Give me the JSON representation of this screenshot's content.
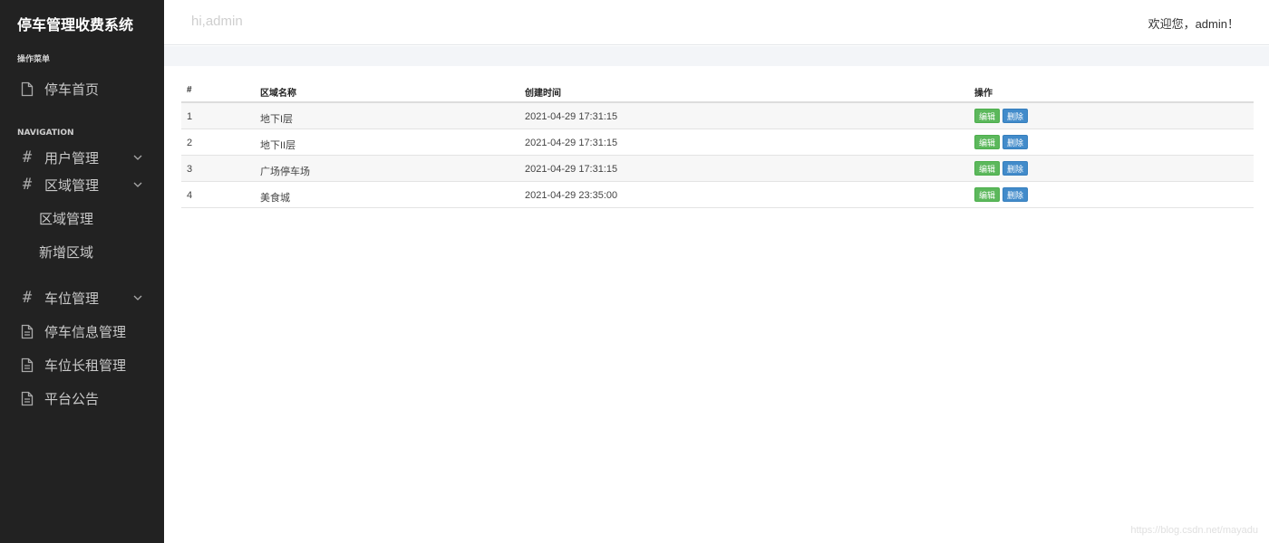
{
  "app": {
    "title": "停车管理收费系统"
  },
  "sidebar": {
    "menu_label": "操作菜单",
    "home_label": "停车首页",
    "nav_label": "NAVIGATION",
    "user_mgmt": "用户管理",
    "area_mgmt": "区域管理",
    "area_sub_list": "区域管理",
    "area_sub_add": "新增区域",
    "space_mgmt": "车位管理",
    "parking_info": "停车信息管理",
    "long_rent": "车位长租管理",
    "notice": "平台公告"
  },
  "header": {
    "greeting": "hi,admin",
    "welcome": "欢迎您，admin！"
  },
  "table": {
    "headers": [
      "#",
      "区域名称",
      "创建时间",
      "操作"
    ],
    "edit_label": "编辑",
    "delete_label": "删除",
    "rows": [
      {
        "id": "1",
        "name": "地下I层",
        "created": "2021-04-29 17:31:15"
      },
      {
        "id": "2",
        "name": "地下II层",
        "created": "2021-04-29 17:31:15"
      },
      {
        "id": "3",
        "name": "广场停车场",
        "created": "2021-04-29 17:31:15"
      },
      {
        "id": "4",
        "name": "美食城",
        "created": "2021-04-29 23:35:00"
      }
    ]
  },
  "watermark": "https://blog.csdn.net/mayadu",
  "colors": {
    "sidebar_bg": "#222222",
    "edit_button": "#5cb85c",
    "delete_button": "#428bca"
  },
  "icons": {
    "home": "file-icon",
    "user_mgmt": "hash-icon",
    "area_mgmt": "hash-icon",
    "space_mgmt": "hash-icon",
    "parking_info": "document-icon",
    "long_rent": "document-icon",
    "notice": "document-icon",
    "expand": "chevron-down-icon"
  }
}
